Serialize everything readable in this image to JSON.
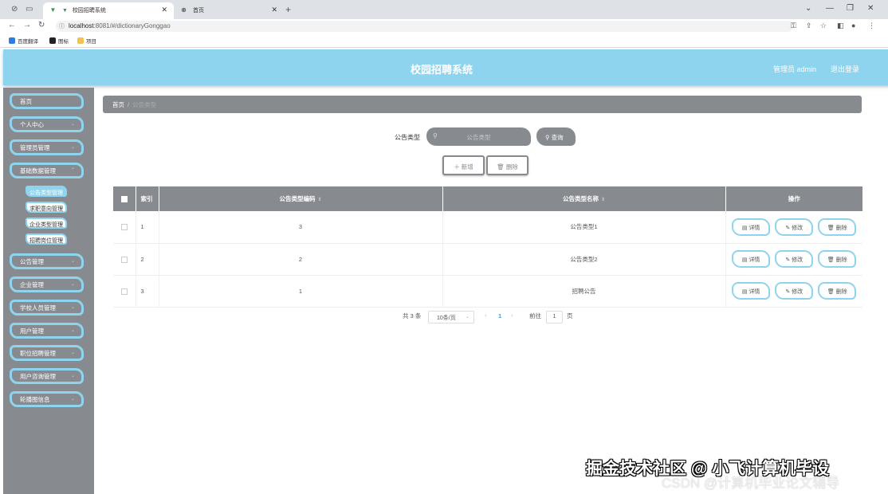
{
  "browser": {
    "tabs": [
      {
        "title": "校园招聘系统",
        "active": true
      },
      {
        "title": "首页",
        "active": false
      }
    ],
    "url_host": "localhost",
    "url_path": ":8081/#/dictionaryGonggao",
    "bookmarks": [
      "百度翻译",
      "图标",
      "项目"
    ]
  },
  "header": {
    "title": "校园招聘系统",
    "user": "管理员 admin",
    "logout": "退出登录",
    "accent": "#8fd4ee"
  },
  "sidebar": {
    "items": [
      {
        "label": "首页",
        "chevron": false
      },
      {
        "label": "个人中心",
        "chevron": true
      },
      {
        "label": "管理员管理",
        "chevron": true
      },
      {
        "label": "基础数据管理",
        "chevron": true
      }
    ],
    "sub_items": [
      {
        "label": "公告类型管理",
        "active": true
      },
      {
        "label": "求职意向管理",
        "active": false
      },
      {
        "label": "企业类型管理",
        "active": false
      },
      {
        "label": "招聘岗位管理",
        "active": false
      }
    ],
    "items_after": [
      {
        "label": "公告管理"
      },
      {
        "label": "企业管理"
      },
      {
        "label": "学校人员管理"
      },
      {
        "label": "用户管理"
      },
      {
        "label": "职位招聘管理"
      },
      {
        "label": "用户咨询管理"
      },
      {
        "label": "轮播图信息"
      }
    ]
  },
  "breadcrumb": {
    "home": "首页",
    "sep": "/",
    "current": "公告类型"
  },
  "search": {
    "label": "公告类型",
    "placeholder": "公告类型",
    "button": "查询"
  },
  "actions": {
    "add": "新增",
    "delete": "删除"
  },
  "table": {
    "columns": [
      "索引",
      "公告类型编码",
      "公告类型名称",
      "操作"
    ],
    "rows": [
      {
        "index": "1",
        "code": "3",
        "name": "公告类型1"
      },
      {
        "index": "2",
        "code": "2",
        "name": "公告类型2"
      },
      {
        "index": "3",
        "code": "1",
        "name": "招聘公告"
      }
    ],
    "row_buttons": {
      "detail": "详情",
      "edit": "修改",
      "delete": "删除"
    }
  },
  "pagination": {
    "total": "共 3 条",
    "page_size": "10条/页",
    "current_page": "1",
    "goto_label": "前往",
    "goto_value": "1",
    "page_suffix": "页"
  },
  "watermark": {
    "line1": "掘金技术社区 @ 小飞计算机毕设",
    "line2": "CSDN @计算机毕业论文辅导"
  }
}
